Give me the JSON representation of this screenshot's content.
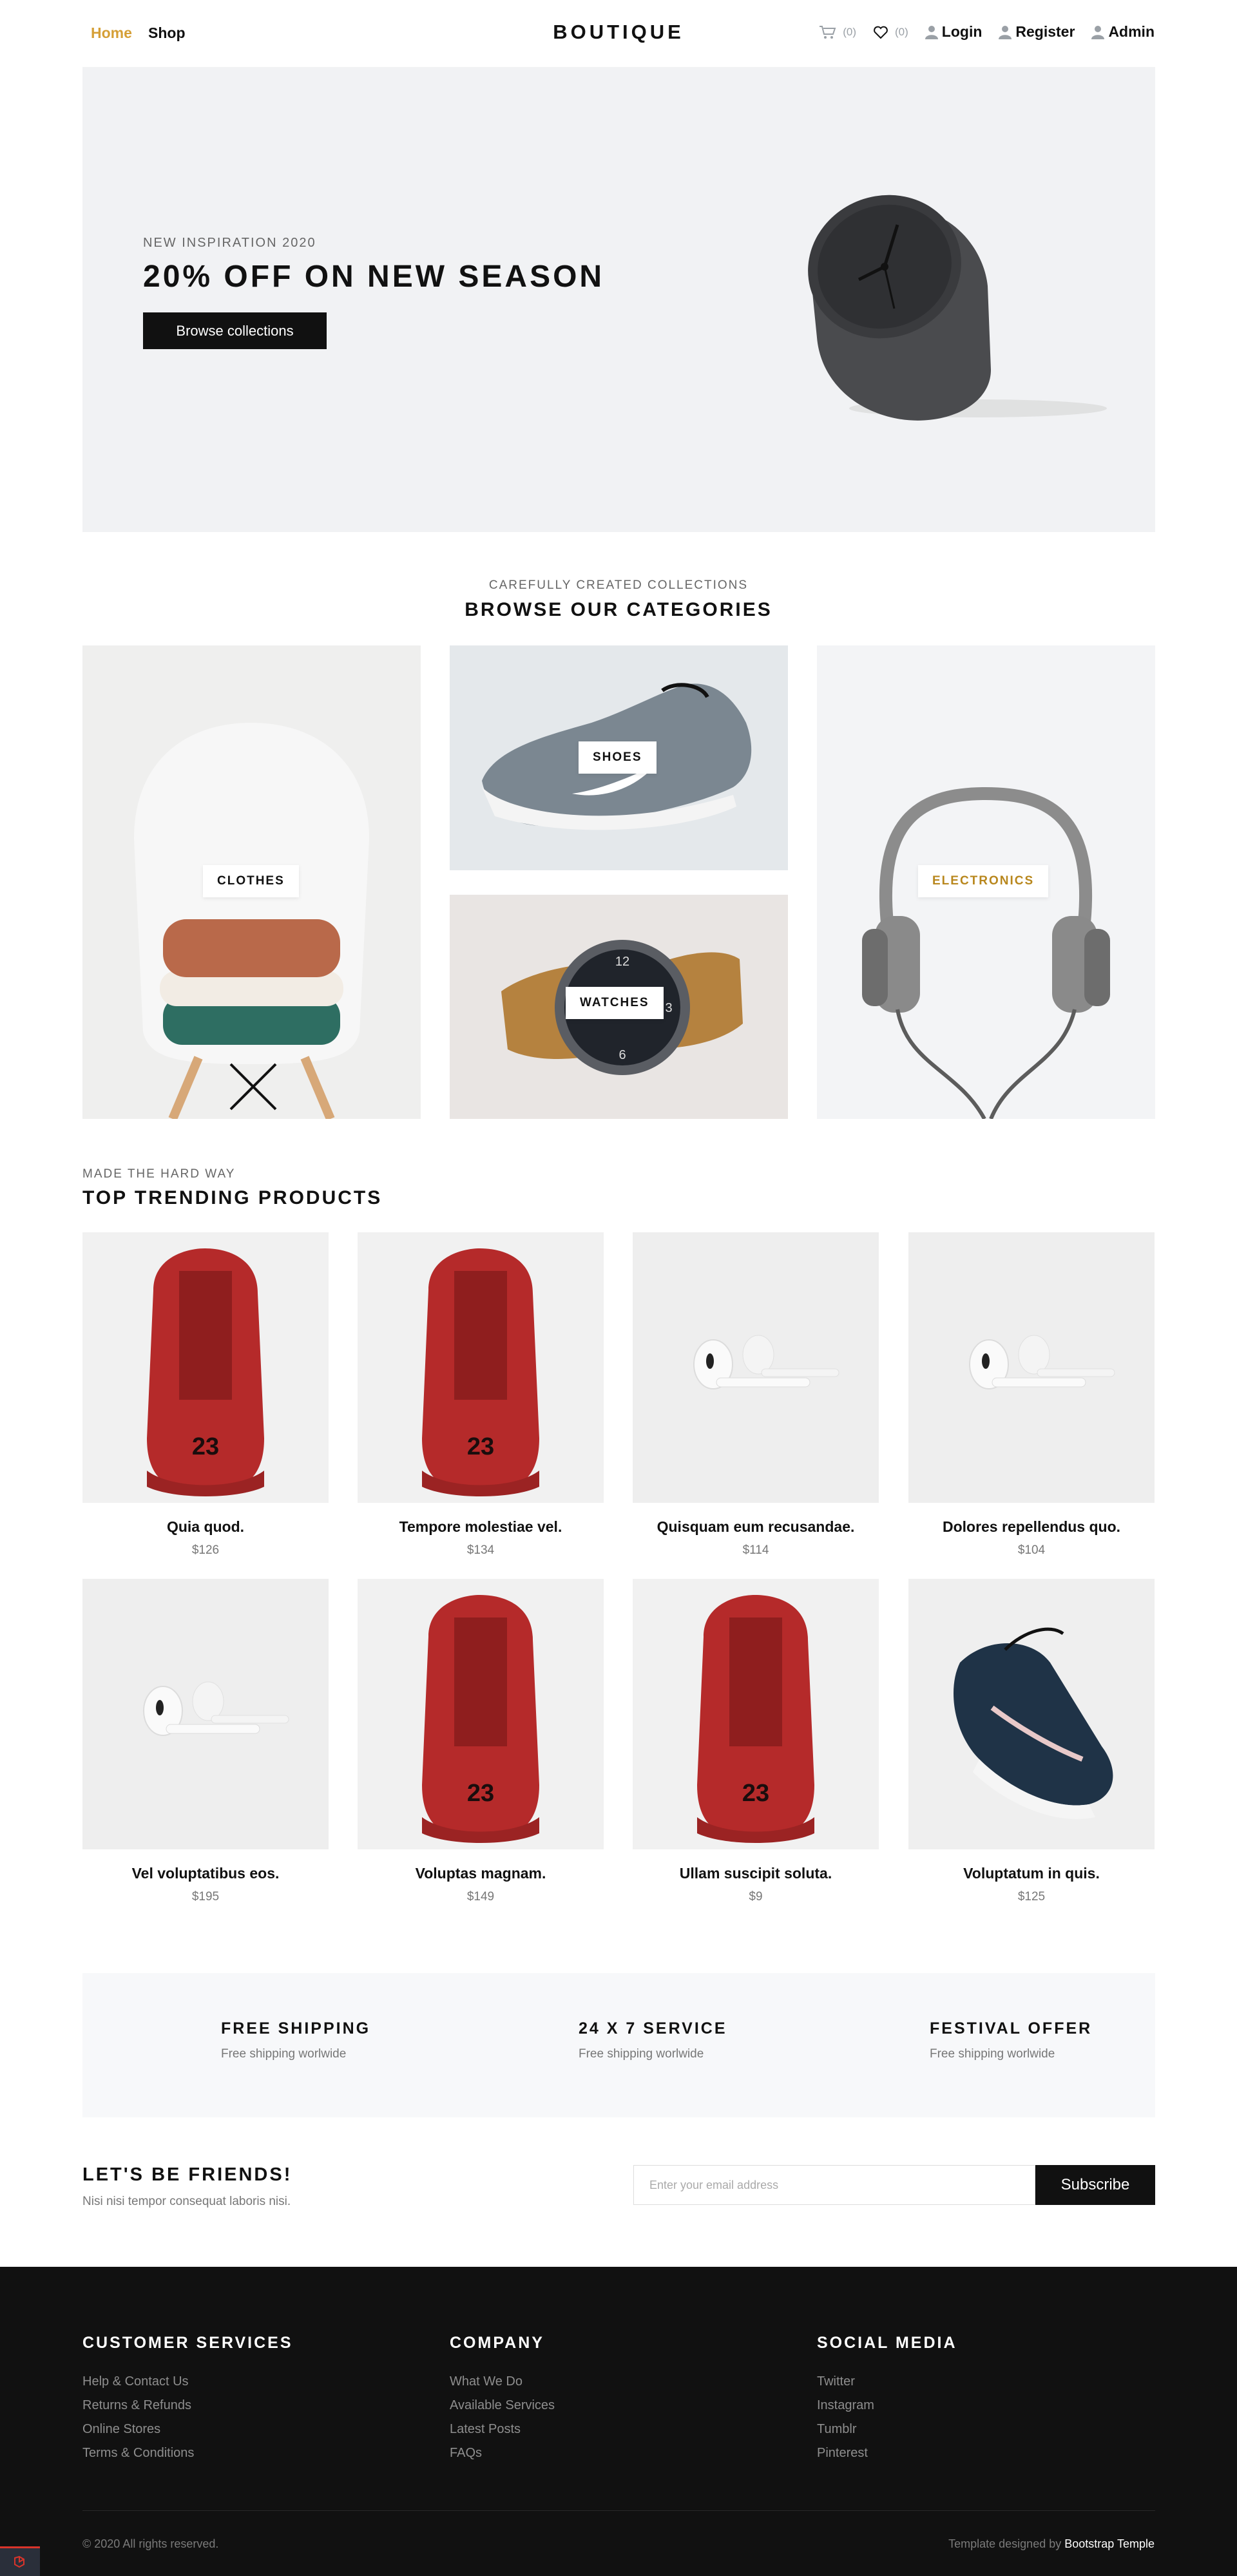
{
  "nav": {
    "home": "Home",
    "shop": "Shop",
    "brand": "BOUTIQUE",
    "cart_count": "(0)",
    "wishlist_count": "(0)",
    "login": "Login",
    "register": "Register",
    "admin": "Admin",
    "accent_color": "#d59f36"
  },
  "hero": {
    "eyebrow": "NEW INSPIRATION 2020",
    "title": "20% OFF ON NEW SEASON",
    "button": "Browse collections"
  },
  "categories": {
    "eyebrow": "CAREFULLY CREATED COLLECTIONS",
    "title": "BROWSE OUR CATEGORIES",
    "items": [
      {
        "label": "CLOTHES"
      },
      {
        "label": "SHOES"
      },
      {
        "label": "WATCHES"
      },
      {
        "label": "ELECTRONICS"
      }
    ]
  },
  "trending": {
    "eyebrow": "MADE THE HARD WAY",
    "title": "TOP TRENDING PRODUCTS",
    "products": [
      {
        "name": "Quia quod.",
        "price": "$126",
        "image": "red-sneaker"
      },
      {
        "name": "Tempore molestiae vel.",
        "price": "$134",
        "image": "red-sneaker"
      },
      {
        "name": "Quisquam eum recusandae.",
        "price": "$114",
        "image": "earbuds"
      },
      {
        "name": "Dolores repellendus quo.",
        "price": "$104",
        "image": "earbuds"
      },
      {
        "name": "Vel voluptatibus eos.",
        "price": "$195",
        "image": "earbuds"
      },
      {
        "name": "Voluptas magnam.",
        "price": "$149",
        "image": "red-sneaker"
      },
      {
        "name": "Ullam suscipit soluta.",
        "price": "$9",
        "image": "red-sneaker"
      },
      {
        "name": "Voluptatum in quis.",
        "price": "$125",
        "image": "navy-sneaker"
      }
    ]
  },
  "services": [
    {
      "title": "FREE SHIPPING",
      "subtitle": "Free shipping worlwide"
    },
    {
      "title": "24 X 7 SERVICE",
      "subtitle": "Free shipping worlwide"
    },
    {
      "title": "FESTIVAL OFFER",
      "subtitle": "Free shipping worlwide"
    }
  ],
  "newsletter": {
    "title": "LET'S BE FRIENDS!",
    "subtitle": "Nisi nisi tempor consequat laboris nisi.",
    "placeholder": "Enter your email address",
    "button": "Subscribe"
  },
  "footer": {
    "columns": [
      {
        "title": "CUSTOMER SERVICES",
        "links": [
          "Help & Contact Us",
          "Returns & Refunds",
          "Online Stores",
          "Terms & Conditions"
        ]
      },
      {
        "title": "COMPANY",
        "links": [
          "What We Do",
          "Available Services",
          "Latest Posts",
          "FAQs"
        ]
      },
      {
        "title": "SOCIAL MEDIA",
        "links": [
          "Twitter",
          "Instagram",
          "Tumblr",
          "Pinterest"
        ]
      }
    ],
    "copyright": "© 2020 All rights reserved.",
    "credit_prefix": "Template designed by",
    "credit_link": "Bootstrap Temple"
  }
}
